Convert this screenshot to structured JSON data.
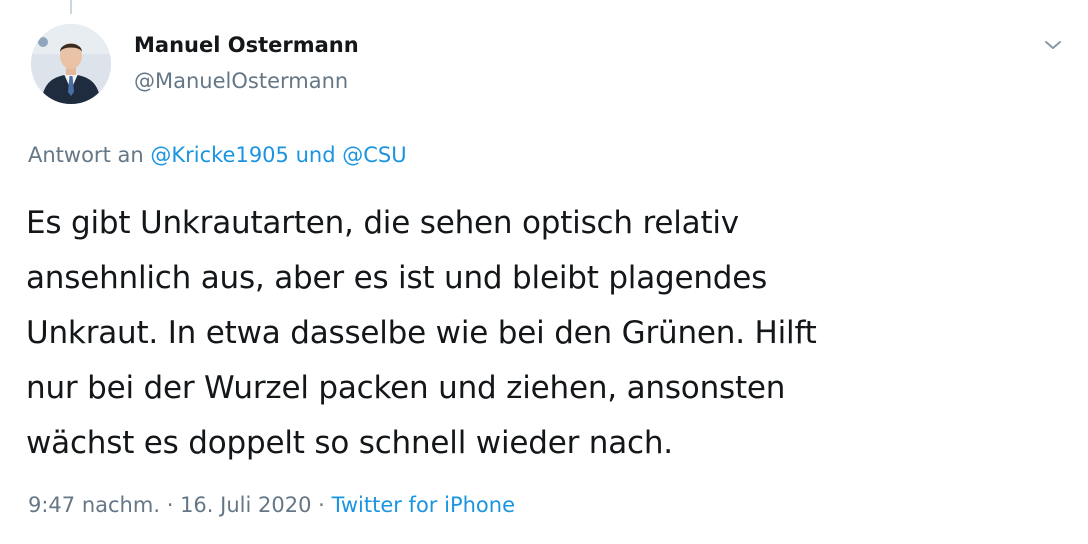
{
  "tweet": {
    "author": {
      "display_name": "Manuel Ostermann",
      "handle": "@ManuelOstermann"
    },
    "reply_to": {
      "prefix": "Antwort an",
      "mention_1": "@Kricke1905",
      "conjunction": "und",
      "mention_2": "@CSU"
    },
    "text_lines": [
      "Es gibt Unkrautarten, die sehen optisch relativ",
      "ansehnlich aus, aber es ist und bleibt plagendes",
      "Unkraut. In etwa dasselbe wie bei den Grünen. Hilft",
      "nur bei der Wurzel packen und ziehen, ansonsten",
      "wächst es doppelt so schnell wieder nach."
    ],
    "meta": {
      "time": "9:47 nachm.",
      "separator": "·",
      "date": "16. Juli 2020",
      "source": "Twitter for iPhone"
    },
    "menu_icon": "chevron-down-icon"
  },
  "colors": {
    "text_primary": "#14171a",
    "text_secondary": "#657786",
    "link": "#1b95e0"
  }
}
